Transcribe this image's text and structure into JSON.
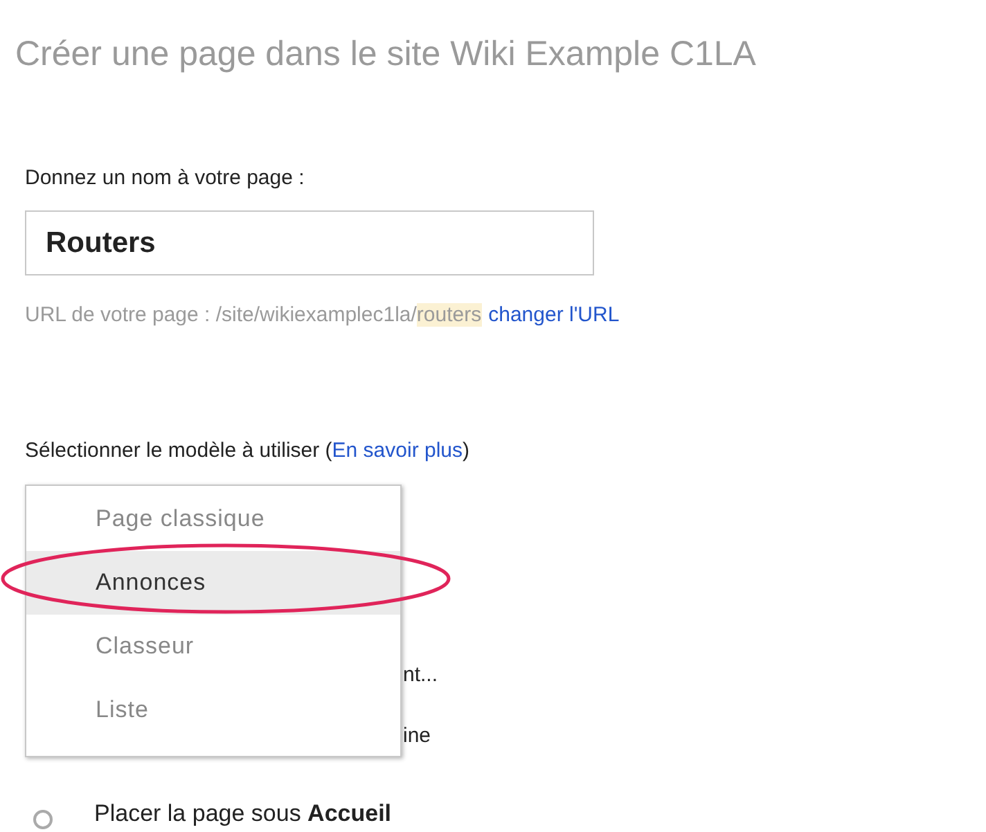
{
  "title": "Créer une page dans le site Wiki Example C1LA",
  "name_field": {
    "label": "Donnez un nom à votre page :",
    "value": "Routers"
  },
  "url": {
    "prefix": "URL de votre page : /site/wikiexamplec1la/",
    "slug": "routers",
    "link": "changer l'URL"
  },
  "template": {
    "label": "Sélectionner le modèle à utiliser (",
    "link": "En savoir plus",
    "label_end": ")",
    "options": [
      {
        "text": "Page classique",
        "selected": false
      },
      {
        "text": "Annonces",
        "selected": true
      },
      {
        "text": "Classeur",
        "selected": false
      },
      {
        "text": "Liste",
        "selected": false
      }
    ]
  },
  "covered_texts": [
    "nt...",
    "ine"
  ],
  "location_options": [
    {
      "text": "Placer la page sous **Accueil**",
      "selected": false
    }
  ]
}
